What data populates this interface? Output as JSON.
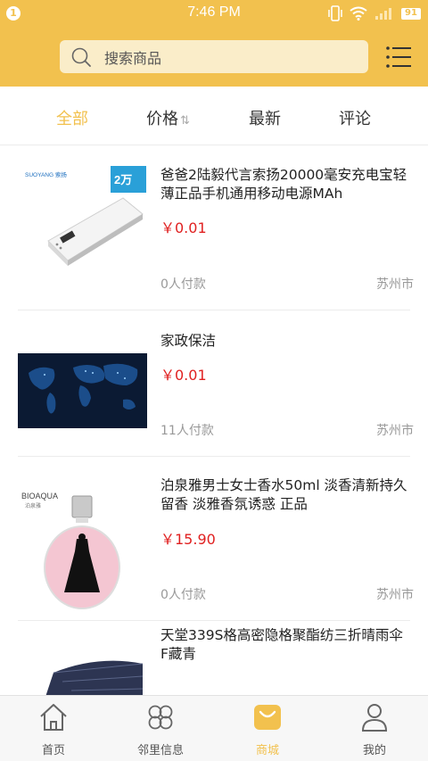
{
  "status_bar": {
    "time": "7:46 PM",
    "notify_badge": "1",
    "battery": "91"
  },
  "search": {
    "placeholder": "搜索商品"
  },
  "tabs": [
    {
      "label": "全部"
    },
    {
      "label": "价格"
    },
    {
      "label": "最新"
    },
    {
      "label": "评论"
    }
  ],
  "products": [
    {
      "title": "爸爸2陆毅代言索扬20000毫安充电宝轻薄正品手机通用移动电源MAh",
      "price": "￥0.01",
      "sold": "0人付款",
      "city": "苏州市",
      "thumb_brand": "SUOYANG 索扬",
      "thumb_badge": "2万"
    },
    {
      "title": "家政保洁",
      "price": "￥0.01",
      "sold": "11人付款",
      "city": "苏州市"
    },
    {
      "title": "泊泉雅男士女士香水50ml 淡香清新持久留香 淡雅香氛诱惑 正品",
      "price": "￥15.90",
      "sold": "0人付款",
      "city": "苏州市",
      "thumb_brand": "BIOAQUA",
      "thumb_brand_sub": "泊泉雅"
    },
    {
      "title": "天堂339S格高密隐格聚酯纺三折晴雨伞 F藏青"
    }
  ],
  "bottom_nav": [
    {
      "label": "首页",
      "icon": "home-icon"
    },
    {
      "label": "邻里信息",
      "icon": "clover-icon"
    },
    {
      "label": "商城",
      "icon": "shopping-bag-icon",
      "active": true
    },
    {
      "label": "我的",
      "icon": "user-icon"
    }
  ],
  "colors": {
    "accent": "#f2c14e",
    "price": "#e02020"
  }
}
